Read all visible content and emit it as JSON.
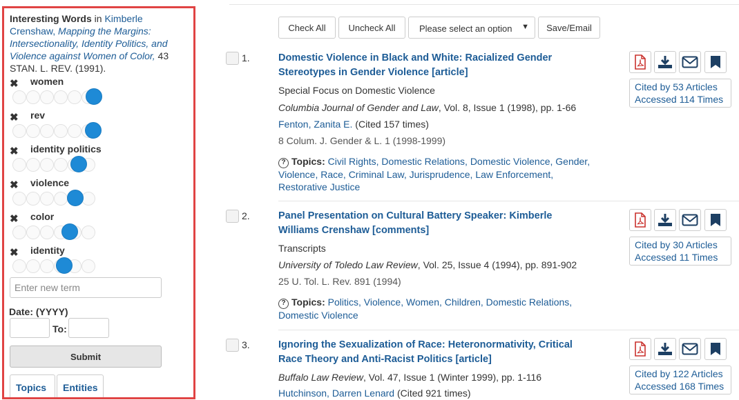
{
  "sidebar": {
    "title": "Interesting Words",
    "in_word": "in",
    "author": "Kimberle Crenshaw,",
    "work": "Mapping the Margins: Intersectionality, Identity Politics, and Violence against Women of Color,",
    "cite": "43 STAN. L. REV. (1991).",
    "terms": [
      {
        "label": "women",
        "level": 1.0
      },
      {
        "label": "rev",
        "level": 0.99
      },
      {
        "label": "identity politics",
        "level": 0.8
      },
      {
        "label": "violence",
        "level": 0.75
      },
      {
        "label": "color",
        "level": 0.68
      },
      {
        "label": "identity",
        "level": 0.6
      }
    ],
    "new_term_placeholder": "Enter new term",
    "date_label": "Date: (YYYY)",
    "to_label": "To:",
    "submit_label": "Submit",
    "tabs": [
      "Topics",
      "Entities"
    ]
  },
  "toolbar": {
    "check_all": "Check All",
    "uncheck_all": "Uncheck All",
    "select_placeholder": "Please select an option",
    "save_email": "Save/Email"
  },
  "results": [
    {
      "num": "1.",
      "title": "Domestic Violence in Black and White: Racialized Gender Stereotypes in Gender Violence [article]",
      "subtitle": "Special Focus on Domestic Violence",
      "journal": "Columbia Journal of Gender and Law",
      "journal_rest": ", Vol. 8, Issue 1 (1998), pp. 1-66",
      "author": "Fenton, Zanita E.",
      "author_cited": " (Cited 157 times)",
      "citation": "8 Colum. J. Gender & L. 1 (1998-1999)",
      "topics_label": "Topics:",
      "topics": "Civil Rights, Domestic Relations, Domestic Violence, Gender, Violence, Race, Criminal Law, Jurisprudence, Law Enforcement, Restorative Justice",
      "cited_by": "Cited by 53 Articles",
      "accessed": "Accessed 114 Times"
    },
    {
      "num": "2.",
      "title": "Panel Presentation on Cultural Battery Speaker: Kimberle Williams Crenshaw [comments]",
      "subtitle": "Transcripts",
      "journal": "University of Toledo Law Review",
      "journal_rest": ", Vol. 25, Issue 4 (1994), pp. 891-902",
      "citation": "25 U. Tol. L. Rev. 891 (1994)",
      "topics_label": "Topics:",
      "topics": "Politics, Violence, Women, Children, Domestic Relations, Domestic Violence",
      "cited_by": "Cited by 30 Articles",
      "accessed": "Accessed 11 Times"
    },
    {
      "num": "3.",
      "title": "Ignoring the Sexualization of Race: Heteronormativity, Critical Race Theory and Anti-Racist Politics [article]",
      "journal": "Buffalo Law Review",
      "journal_rest": ", Vol. 47, Issue 1 (Winter 1999), pp. 1-116",
      "author": "Hutchinson, Darren Lenard",
      "author_cited": " (Cited 921 times)",
      "cited_by": "Cited by 122 Articles",
      "accessed": "Accessed 168 Times"
    }
  ],
  "icons": [
    "pdf-icon",
    "download-icon",
    "email-icon",
    "bookmark-icon",
    "question-icon",
    "close-icon"
  ],
  "colors": {
    "link": "#1d5c96",
    "accent": "#1e8ad6",
    "highlight_border": "#e04343",
    "pdf_red": "#c9302c",
    "icon_dark": "#1d3f63"
  }
}
